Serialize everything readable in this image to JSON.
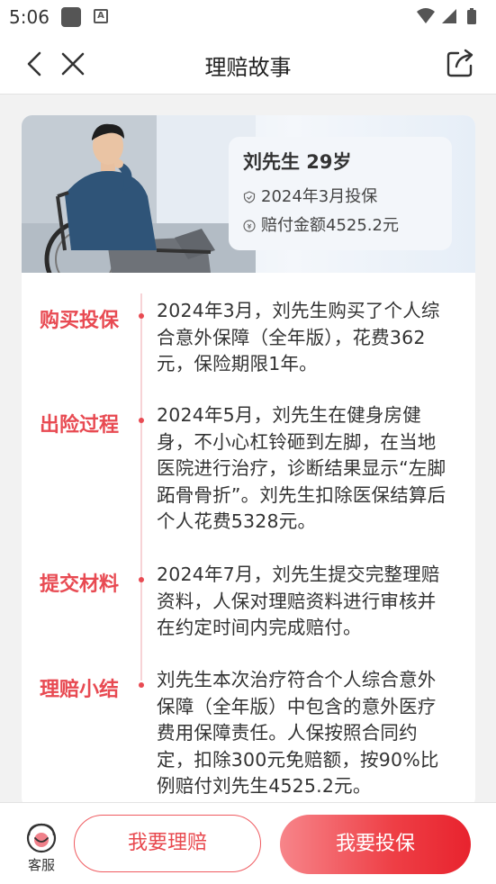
{
  "status_bar": {
    "time": "5:06",
    "a_icon": "A"
  },
  "nav": {
    "title": "理赔故事"
  },
  "hero": {
    "name_age": "刘先生 29岁",
    "insured_date": "2024年3月投保",
    "payout": "赔付金额4525.2元"
  },
  "timeline": [
    {
      "label": "购买投保",
      "text": "2024年3月，刘先生购买了个人综合意外保障（全年版），花费362元，保险期限1年。"
    },
    {
      "label": "出险过程",
      "text": "2024年5月，刘先生在健身房健身，不小心杠铃砸到左脚，在当地医院进行治疗，诊断结果显示“左脚跖骨骨折”。刘先生扣除医保结算后个人花费5328元。"
    },
    {
      "label": "提交材料",
      "text": "2024年7月，刘先生提交完整理赔资料，人保对理赔资料进行审核并在约定时间内完成赔付。"
    },
    {
      "label": "理赔小结",
      "text": "刘先生本次治疗符合个人综合意外保障（全年版）中包含的意外医疗费用保障责任。人保按照合同约定，扣除300元免赔额，按90%比例赔付刘先生4525.2元。"
    }
  ],
  "bottom": {
    "service_label": "客服",
    "claim_button": "我要理赔",
    "buy_button": "我要投保"
  },
  "colors": {
    "accent": "#e84a52",
    "button_gradient_end": "#e8232e"
  }
}
